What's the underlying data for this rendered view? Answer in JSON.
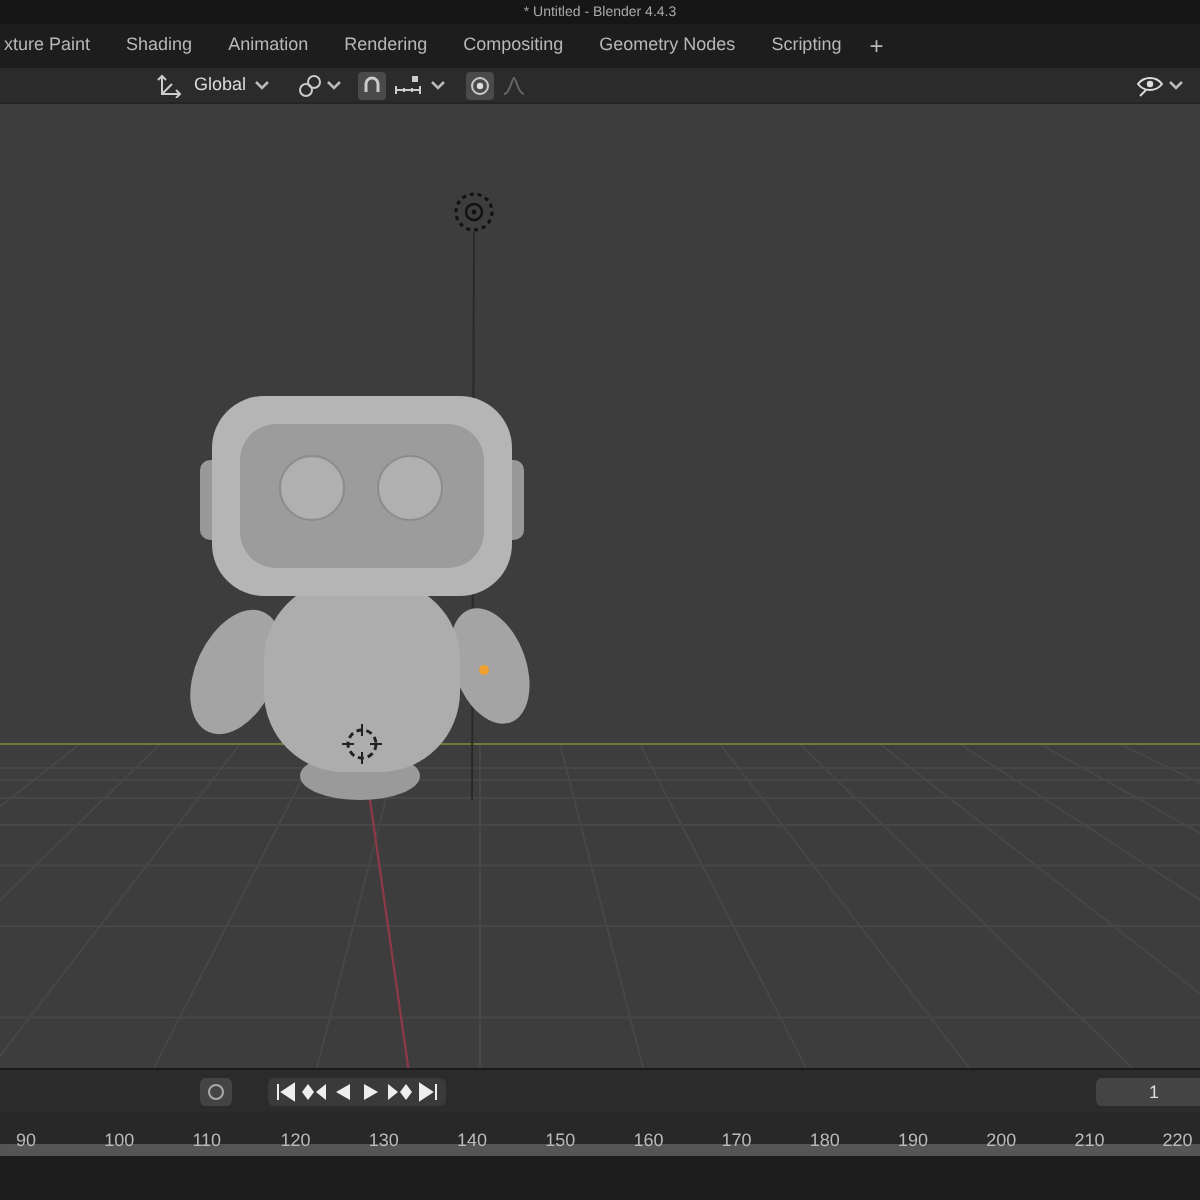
{
  "window": {
    "title": "* Untitled - Blender 4.4.3"
  },
  "workspace_tabs": [
    "xture Paint",
    "Shading",
    "Animation",
    "Rendering",
    "Compositing",
    "Geometry Nodes",
    "Scripting"
  ],
  "add_tab": "+",
  "toolbar": {
    "orientation": "Global",
    "snap_on": true,
    "proportional_on": true
  },
  "timeline": {
    "auto_keying": false,
    "current_frame": "1",
    "ruler": [
      "90",
      "100",
      "110",
      "120",
      "130",
      "140",
      "150",
      "160",
      "170",
      "180",
      "190",
      "200",
      "210",
      "220"
    ]
  }
}
